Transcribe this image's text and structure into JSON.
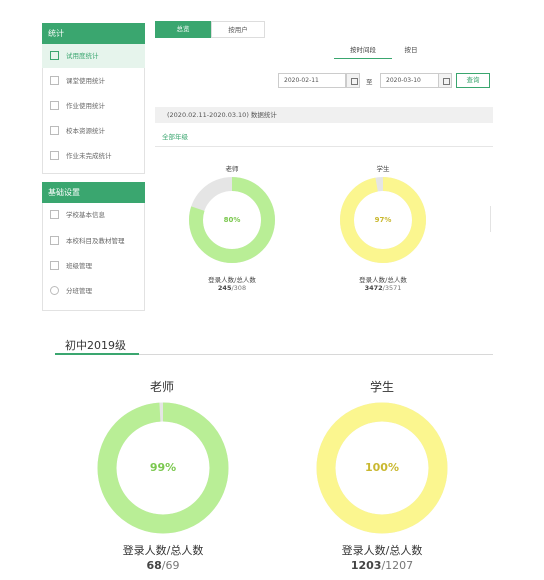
{
  "sidebar": {
    "section1_title": "统计",
    "section1_items": [
      {
        "label": "试用度统计",
        "icon": "edit-icon"
      },
      {
        "label": "课堂使用统计",
        "icon": "classroom-icon"
      },
      {
        "label": "作业使用统计",
        "icon": "homework-icon"
      },
      {
        "label": "校本资源统计",
        "icon": "bar-chart-icon"
      },
      {
        "label": "作业未完成统计",
        "icon": "list-icon"
      }
    ],
    "section2_title": "基础设置",
    "section2_items": [
      {
        "label": "学校基本信息",
        "icon": "school-icon"
      },
      {
        "label": "本校科目及教材管理",
        "icon": "book-icon"
      },
      {
        "label": "班级管理",
        "icon": "class-icon"
      },
      {
        "label": "分班管理",
        "icon": "group-icon"
      }
    ]
  },
  "tabs": {
    "overview": "总览",
    "by_user": "按用户"
  },
  "subtabs": {
    "by_period": "按时间段",
    "by_day": "按日"
  },
  "filter": {
    "start_date": "2020-02-11",
    "to_label": "至",
    "end_date": "2020-03-10",
    "query_button": "查询"
  },
  "stats_bar": "(2020.02.11-2020.03.10) 数据统计",
  "grade_tab_all": "全部年级",
  "overview_donuts": [
    {
      "label": "老师",
      "percent": "80%",
      "value": 0.8,
      "caption": "登录人数/总人数",
      "logged": "245",
      "total": "/308",
      "color": "#b9ee96",
      "track": "#e5e5e5",
      "pct_color": "#7bc84f"
    },
    {
      "label": "学生",
      "percent": "97%",
      "value": 0.97,
      "caption": "登录人数/总人数",
      "logged": "3472",
      "total": "/3571",
      "color": "#fbf68f",
      "track": "#e5e5e5",
      "pct_color": "#c9b830"
    }
  ],
  "grade_section": {
    "title": "初中2019级",
    "donuts": [
      {
        "label": "老师",
        "percent": "99%",
        "value": 0.99,
        "caption": "登录人数/总人数",
        "logged": "68",
        "total": "/69",
        "color": "#b9ee96",
        "track": "#e5e5e5",
        "pct_color": "#7bc84f"
      },
      {
        "label": "学生",
        "percent": "100%",
        "value": 1.0,
        "caption": "登录人数/总人数",
        "logged": "1203",
        "total": "/1207",
        "color": "#fbf68f",
        "track": "#e5e5e5",
        "pct_color": "#c9b830"
      }
    ]
  },
  "colors": {
    "accent": "#3aa66f"
  }
}
